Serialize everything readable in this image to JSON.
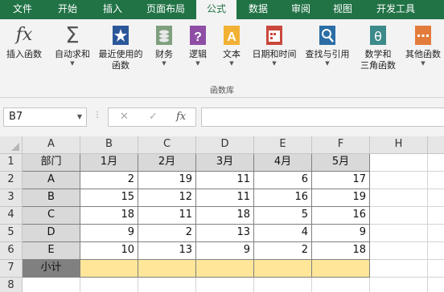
{
  "ribbon_tabs": [
    "文件",
    "开始",
    "插入",
    "页面布局",
    "公式",
    "数据",
    "审阅",
    "视图",
    "开发工具"
  ],
  "active_tab": "公式",
  "ribbon": {
    "insert_function": "插入函数",
    "autosum": "自动求和",
    "recent_1": "最近使用的",
    "recent_2": "函数",
    "financial": "财务",
    "logical": "逻辑",
    "text": "文本",
    "datetime": "日期和时间",
    "lookup": "查找与引用",
    "math_1": "数学和",
    "math_2": "三角函数",
    "more": "其他函数",
    "group_label": "函数库",
    "fx_symbol": "fx",
    "sigma_symbol": "Σ"
  },
  "formula_bar": {
    "name_box": "B7",
    "cancel": "✕",
    "enter": "✓",
    "fx": "fx",
    "formula": ""
  },
  "columns": [
    "A",
    "B",
    "C",
    "D",
    "E",
    "F",
    "H"
  ],
  "rows": [
    "1",
    "2",
    "3",
    "4",
    "5",
    "6",
    "7",
    "8"
  ],
  "table": {
    "headers": [
      "部门",
      "1月",
      "2月",
      "3月",
      "4月",
      "5月"
    ],
    "rows": [
      {
        "dept": "A",
        "values": [
          "2",
          "19",
          "11",
          "6",
          "17"
        ]
      },
      {
        "dept": "B",
        "values": [
          "15",
          "12",
          "11",
          "16",
          "19"
        ]
      },
      {
        "dept": "C",
        "values": [
          "18",
          "11",
          "18",
          "5",
          "16"
        ]
      },
      {
        "dept": "D",
        "values": [
          "9",
          "2",
          "13",
          "4",
          "9"
        ]
      },
      {
        "dept": "E",
        "values": [
          "10",
          "13",
          "9",
          "2",
          "18"
        ]
      }
    ],
    "subtotal_label": "小计"
  },
  "colors": {
    "excel_green": "#217346",
    "header_fill": "#d9d9d9",
    "subtotal_fill": "#ffe699",
    "subtotal_label_fill": "#808080"
  }
}
